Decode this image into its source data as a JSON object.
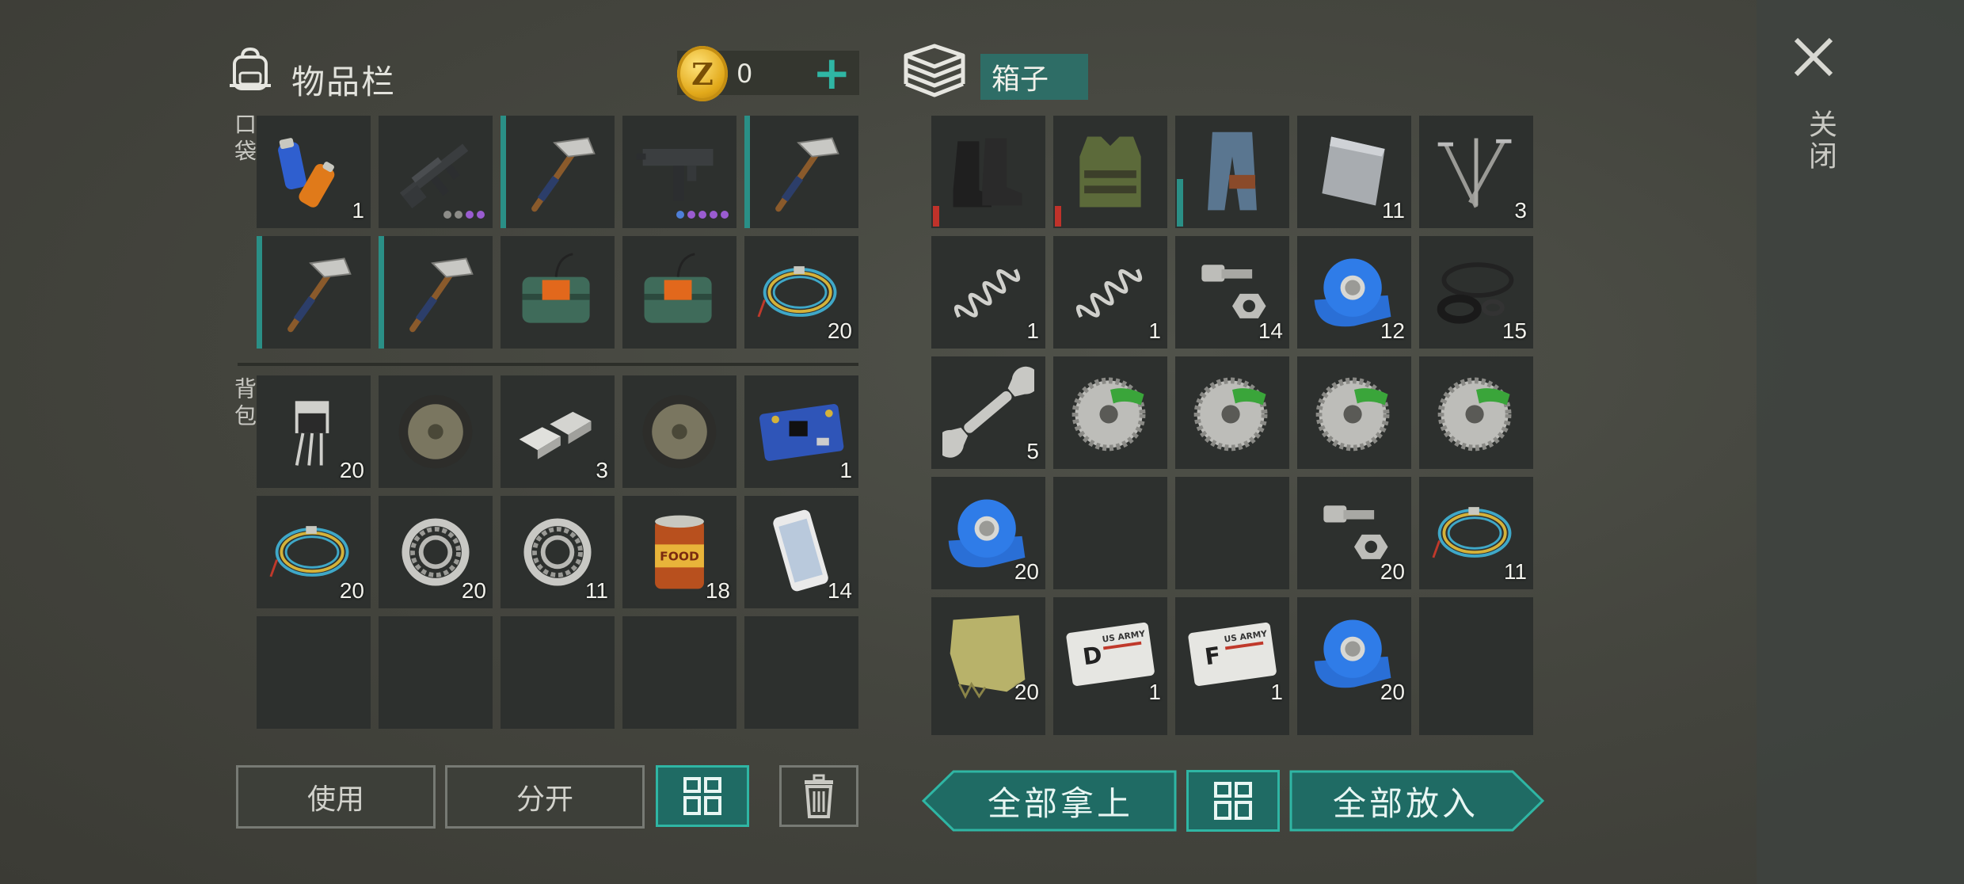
{
  "inventory": {
    "title": "物品栏",
    "coin_symbol": "Z",
    "coins": "0",
    "add_label": "+",
    "pocket_label": "口袋",
    "backpack_label": "背包",
    "pocket_slots": [
      {
        "icon": "batteries-icon",
        "count": "1"
      },
      {
        "icon": "assault-rifle-icon",
        "count": "",
        "dots": [
          "#8c8c88",
          "#8c8c88",
          "#9a5cd0",
          "#9a5cd0"
        ]
      },
      {
        "icon": "pickaxe-icon",
        "count": "",
        "bar": true
      },
      {
        "icon": "uzi-icon",
        "count": "",
        "dots": [
          "#4e7fd8",
          "#9a5cd0",
          "#9a5cd0",
          "#9a5cd0",
          "#9a5cd0"
        ]
      },
      {
        "icon": "pickaxe-icon",
        "count": "",
        "bar": true
      },
      {
        "icon": "pickaxe-icon",
        "count": "",
        "bar": true
      },
      {
        "icon": "pickaxe-icon",
        "count": "",
        "bar": true
      },
      {
        "icon": "c4-explosive-icon",
        "count": ""
      },
      {
        "icon": "c4-explosive-icon",
        "count": ""
      },
      {
        "icon": "wire-coil-icon",
        "count": "20"
      }
    ],
    "backpack_slots": [
      {
        "icon": "transistor-icon",
        "count": "20"
      },
      {
        "icon": "tire-icon",
        "count": ""
      },
      {
        "icon": "aluminum-ingot-icon",
        "count": "3"
      },
      {
        "icon": "tire-icon",
        "count": ""
      },
      {
        "icon": "circuit-board-icon",
        "count": "1"
      },
      {
        "icon": "wire-coil-icon",
        "count": "20"
      },
      {
        "icon": "bearing-icon",
        "count": "20"
      },
      {
        "icon": "bearing-icon",
        "count": "11"
      },
      {
        "icon": "food-can-icon",
        "count": "18"
      },
      {
        "icon": "smartphone-icon",
        "count": "14"
      },
      {
        "icon": "empty",
        "count": ""
      },
      {
        "icon": "empty",
        "count": ""
      },
      {
        "icon": "empty",
        "count": ""
      },
      {
        "icon": "empty",
        "count": ""
      },
      {
        "icon": "empty",
        "count": ""
      }
    ],
    "buttons": {
      "use": "使用",
      "split": "分开"
    }
  },
  "box": {
    "title": "箱子",
    "close_label": "关闭",
    "slots": [
      {
        "icon": "boots-icon",
        "count": "",
        "red": true
      },
      {
        "icon": "armor-vest-icon",
        "count": "",
        "red": true
      },
      {
        "icon": "pants-icon",
        "count": "",
        "teal": true
      },
      {
        "icon": "metal-plate-icon",
        "count": "11"
      },
      {
        "icon": "nails-icon",
        "count": "3"
      },
      {
        "icon": "spring-icon",
        "count": "1"
      },
      {
        "icon": "spring-icon",
        "count": "1"
      },
      {
        "icon": "bolt-nut-icon",
        "count": "14"
      },
      {
        "icon": "blue-tape-icon",
        "count": "12"
      },
      {
        "icon": "rubber-rings-icon",
        "count": "15"
      },
      {
        "icon": "wrench-icon",
        "count": "5"
      },
      {
        "icon": "saw-blade-icon",
        "count": ""
      },
      {
        "icon": "saw-blade-icon",
        "count": ""
      },
      {
        "icon": "saw-blade-icon",
        "count": ""
      },
      {
        "icon": "saw-blade-icon",
        "count": ""
      },
      {
        "icon": "blue-tape-icon",
        "count": "20"
      },
      {
        "icon": "empty",
        "count": ""
      },
      {
        "icon": "empty",
        "count": ""
      },
      {
        "icon": "bolt-nut-icon",
        "count": "20"
      },
      {
        "icon": "wire-coil-icon",
        "count": "11"
      },
      {
        "icon": "cloth-icon",
        "count": "20"
      },
      {
        "icon": "army-card-d-icon",
        "count": "1",
        "letter": "D"
      },
      {
        "icon": "army-card-f-icon",
        "count": "1",
        "letter": "F"
      },
      {
        "icon": "blue-tape-icon",
        "count": "20"
      },
      {
        "icon": "empty",
        "count": ""
      }
    ],
    "card_text": "US ARMY",
    "buttons": {
      "take_all": "全部拿上",
      "put_all": "全部放入"
    }
  },
  "colors": {
    "accent": "#2fb6a4",
    "accent_dark": "#1f6b64",
    "slot_bg": "#2d302e"
  }
}
